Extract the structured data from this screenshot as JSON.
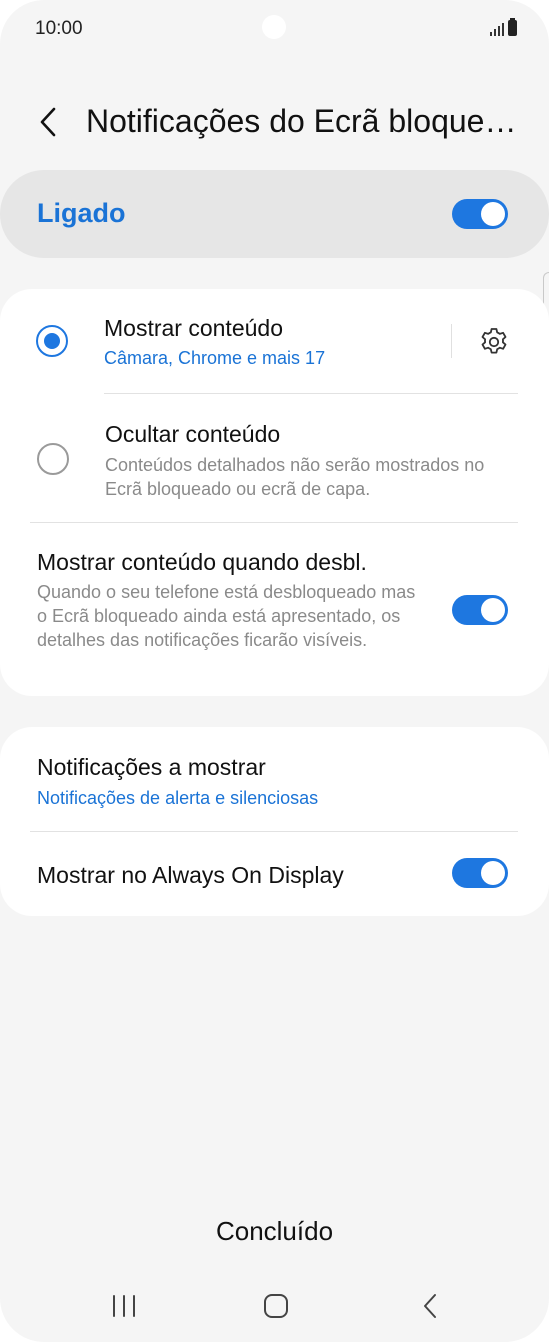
{
  "status_bar": {
    "time": "10:00"
  },
  "header": {
    "title": "Notificações do Ecrã bloque…"
  },
  "master_switch": {
    "label": "Ligado",
    "on": true
  },
  "content_options": [
    {
      "title": "Mostrar conteúdo",
      "subtitle": "Câmara, Chrome e mais 17",
      "selected": true,
      "icon": "gear-icon"
    },
    {
      "title": "Ocultar conteúdo",
      "subtitle": "Conteúdos detalhados não serão mostrados no Ecrã bloqueado ou ecrã de capa.",
      "selected": false
    }
  ],
  "show_when_unlocked": {
    "title": "Mostrar conteúdo quando desbl.",
    "description": "Quando o seu telefone está desbloqueado mas o Ecrã bloqueado ainda está apresentado, os detalhes das notificações ficarão visíveis.",
    "on": true
  },
  "notifications_to_show": {
    "title": "Notificações a mostrar",
    "value": "Notificações de alerta e silenciosas"
  },
  "always_on_display": {
    "title": "Mostrar no Always On Display",
    "on": true
  },
  "footer": {
    "done_label": "Concluído"
  },
  "nav_bar": {
    "icons": [
      "recent-apps-icon",
      "home-icon",
      "back-icon"
    ]
  },
  "colors": {
    "accent": "#1e77e0",
    "background": "#f5f5f5",
    "card": "#ffffff"
  }
}
